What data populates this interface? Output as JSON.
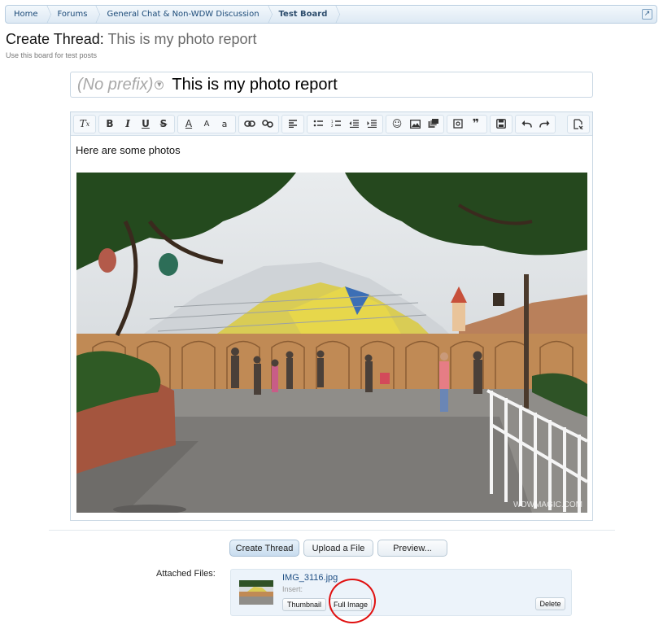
{
  "breadcrumb": {
    "items": [
      "Home",
      "Forums",
      "General Chat & Non-WDW Discussion",
      "Test Board"
    ],
    "jump_icon": "external-link-icon"
  },
  "page": {
    "title_prefix": "Create Thread:",
    "thread_title": "This is my photo report",
    "description": "Use this board for test posts"
  },
  "title_field": {
    "prefix": "(No prefix)",
    "value": "This is my photo report"
  },
  "editor": {
    "toolbar_icons": [
      [
        "remove-format-icon"
      ],
      [
        "bold-icon",
        "italic-icon",
        "underline-icon",
        "strikethrough-icon"
      ],
      [
        "text-color-icon",
        "font-size-icon",
        "font-family-icon"
      ],
      [
        "link-icon",
        "unlink-icon"
      ],
      [
        "align-icon"
      ],
      [
        "bullet-list-icon",
        "numbered-list-icon",
        "outdent-icon",
        "indent-icon"
      ],
      [
        "smilie-icon",
        "image-icon",
        "media-icon"
      ],
      [
        "code-icon",
        "quote-icon"
      ],
      [
        "save-draft-icon"
      ],
      [
        "undo-icon",
        "redo-icon"
      ]
    ],
    "toolbar_glyphs": {
      "bold-icon": "B",
      "italic-icon": "I",
      "underline-icon": "U",
      "strikethrough-icon": "S",
      "text-color-icon": "A",
      "font-size-icon": "A",
      "font-family-icon": "a",
      "remove-format-icon": "Tx"
    },
    "body_text": "Here are some photos",
    "image_watermark": "WDWMAGIC.COM"
  },
  "buttons": {
    "create_thread": "Create Thread",
    "upload_file": "Upload a File",
    "preview": "Preview..."
  },
  "attachments": {
    "label": "Attached Files:",
    "file_name": "IMG_3116.jpg",
    "insert_label": "Insert:",
    "thumbnail_button": "Thumbnail",
    "full_image_button": "Full Image",
    "delete_button": "Delete"
  },
  "colors": {
    "accent": "#1f4f84",
    "breadcrumb_bg": "#dde9f4",
    "highlight": "#e01010"
  }
}
